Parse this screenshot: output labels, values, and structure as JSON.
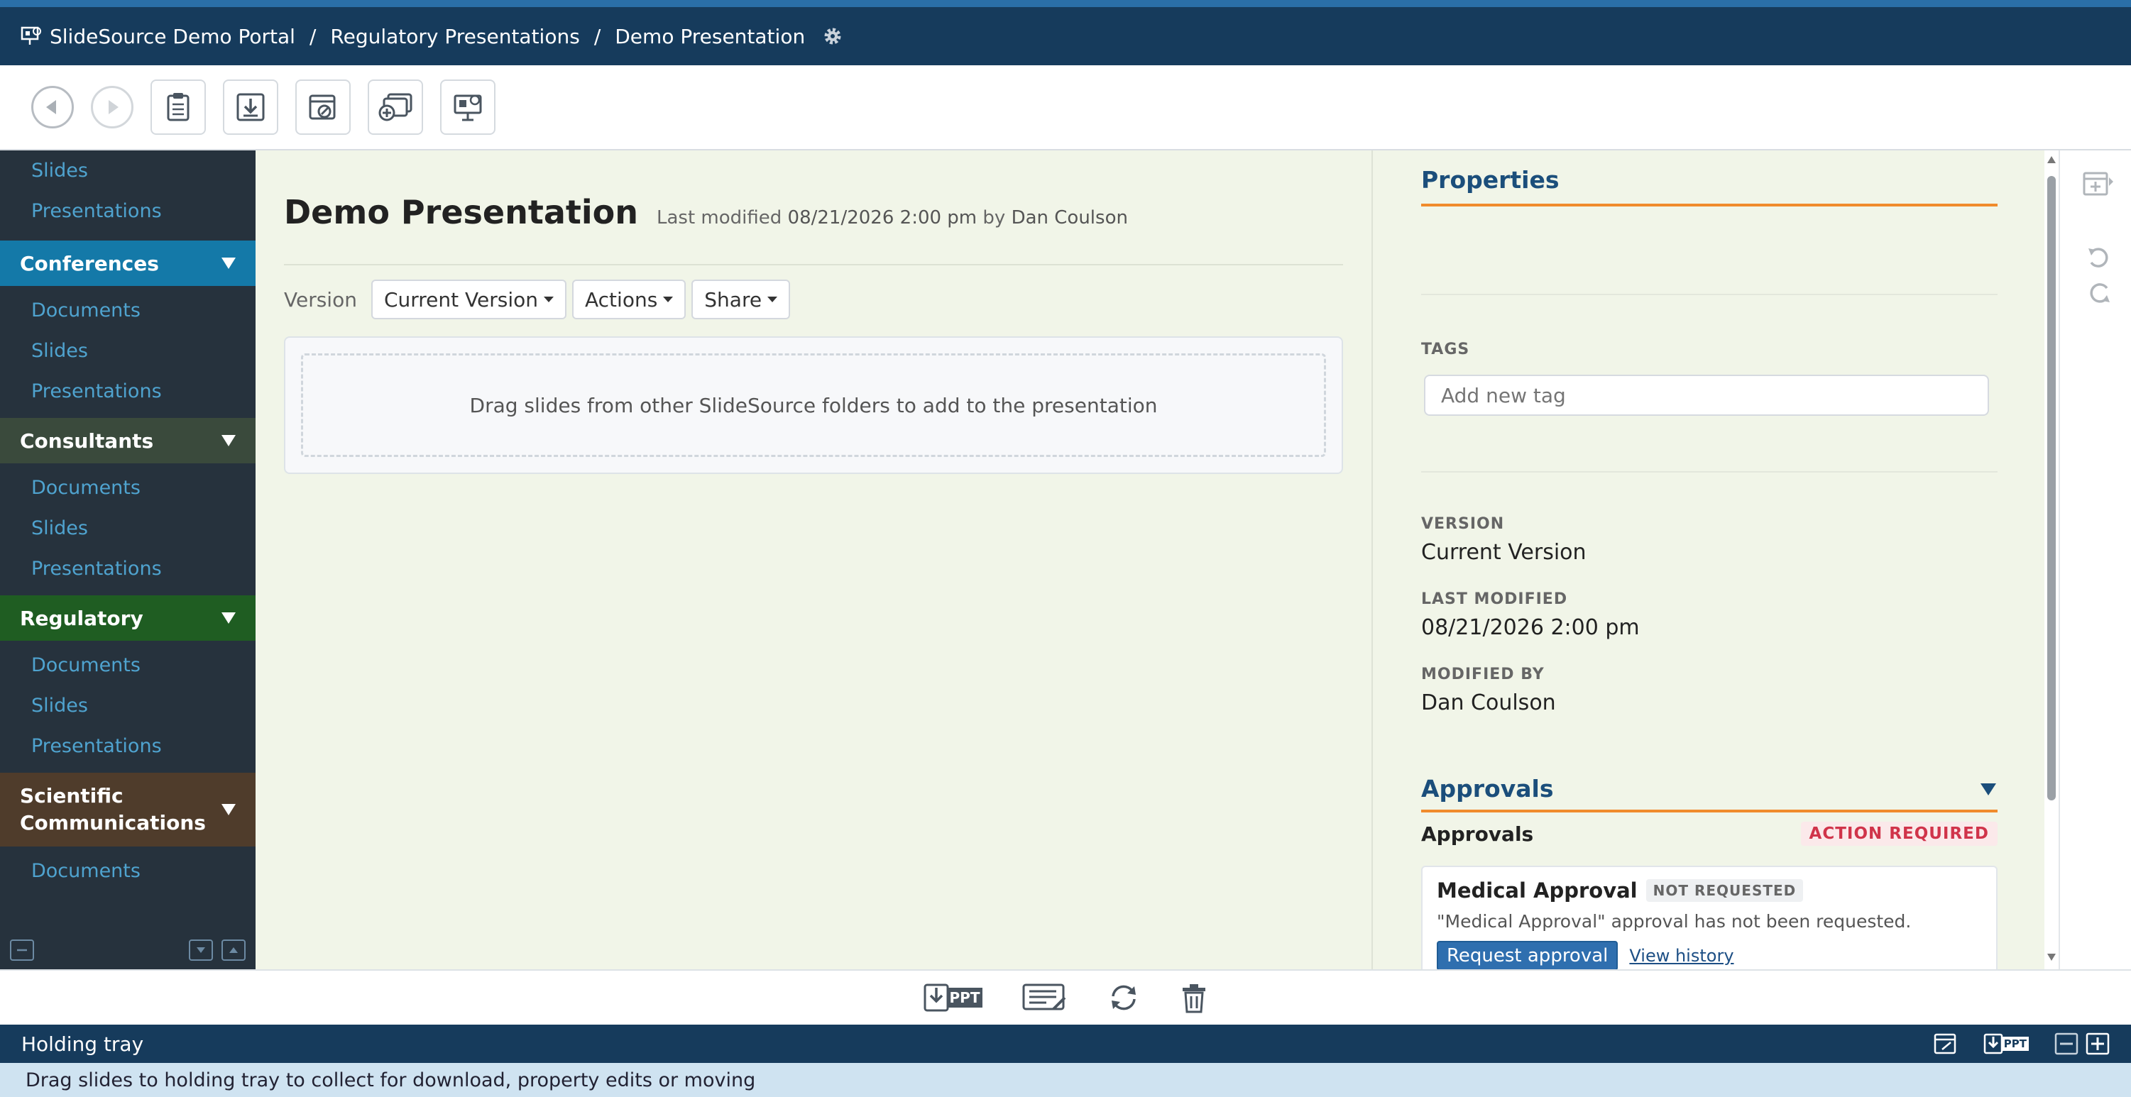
{
  "header": {
    "breadcrumb": [
      "SlideSource Demo Portal",
      "Regulatory Presentations",
      "Demo Presentation"
    ],
    "separator": "/"
  },
  "sidebar": {
    "top_links": [
      "Slides",
      "Presentations"
    ],
    "sections": [
      {
        "title": "Conferences",
        "color": "#1479a8",
        "links": [
          "Documents",
          "Slides",
          "Presentations"
        ]
      },
      {
        "title": "Consultants",
        "color": "#3a4a3c",
        "links": [
          "Documents",
          "Slides",
          "Presentations"
        ]
      },
      {
        "title": "Regulatory",
        "color": "#1f5d22",
        "links": [
          "Documents",
          "Slides",
          "Presentations"
        ]
      },
      {
        "title": "Scientific Communications",
        "title_line1": "Scientific",
        "title_line2": "Communications",
        "color": "#4f3c2b",
        "links": [
          "Documents"
        ]
      }
    ]
  },
  "main": {
    "title": "Demo Presentation",
    "meta_prefix": "Last modified",
    "meta_date": "08/21/2026 2:00 pm",
    "meta_by": "by",
    "meta_author": "Dan Coulson",
    "version_label": "Version",
    "version_dropdown": "Current Version",
    "actions_dropdown": "Actions",
    "share_dropdown": "Share",
    "drop_hint": "Drag slides from other SlideSource folders to add to the presentation"
  },
  "properties": {
    "heading": "Properties",
    "tags_label": "TAGS",
    "tag_placeholder": "Add new tag",
    "version_label": "VERSION",
    "version_value": "Current Version",
    "last_modified_label": "LAST MODIFIED",
    "last_modified_value": "08/21/2026 2:00 pm",
    "modified_by_label": "MODIFIED BY",
    "modified_by_value": "Dan Coulson",
    "approvals_heading": "Approvals",
    "approvals_label": "Approvals",
    "action_required": "ACTION REQUIRED",
    "medical_title": "Medical Approval",
    "medical_status": "NOT REQUESTED",
    "medical_desc": "\"Medical Approval\" approval has not been requested.",
    "request_button": "Request approval",
    "history_link": "View history"
  },
  "bottom_bar": {
    "ppt_label": "PPT"
  },
  "tray": {
    "title": "Holding tray",
    "hint": "Drag slides to holding tray to collect for download, property edits or moving",
    "ppt_label": "PPT"
  },
  "colors": {
    "header_bg": "#163b5c",
    "accent_orange": "#f08b2c",
    "link_blue": "#4fa3cf",
    "button_blue": "#2f6faf"
  }
}
